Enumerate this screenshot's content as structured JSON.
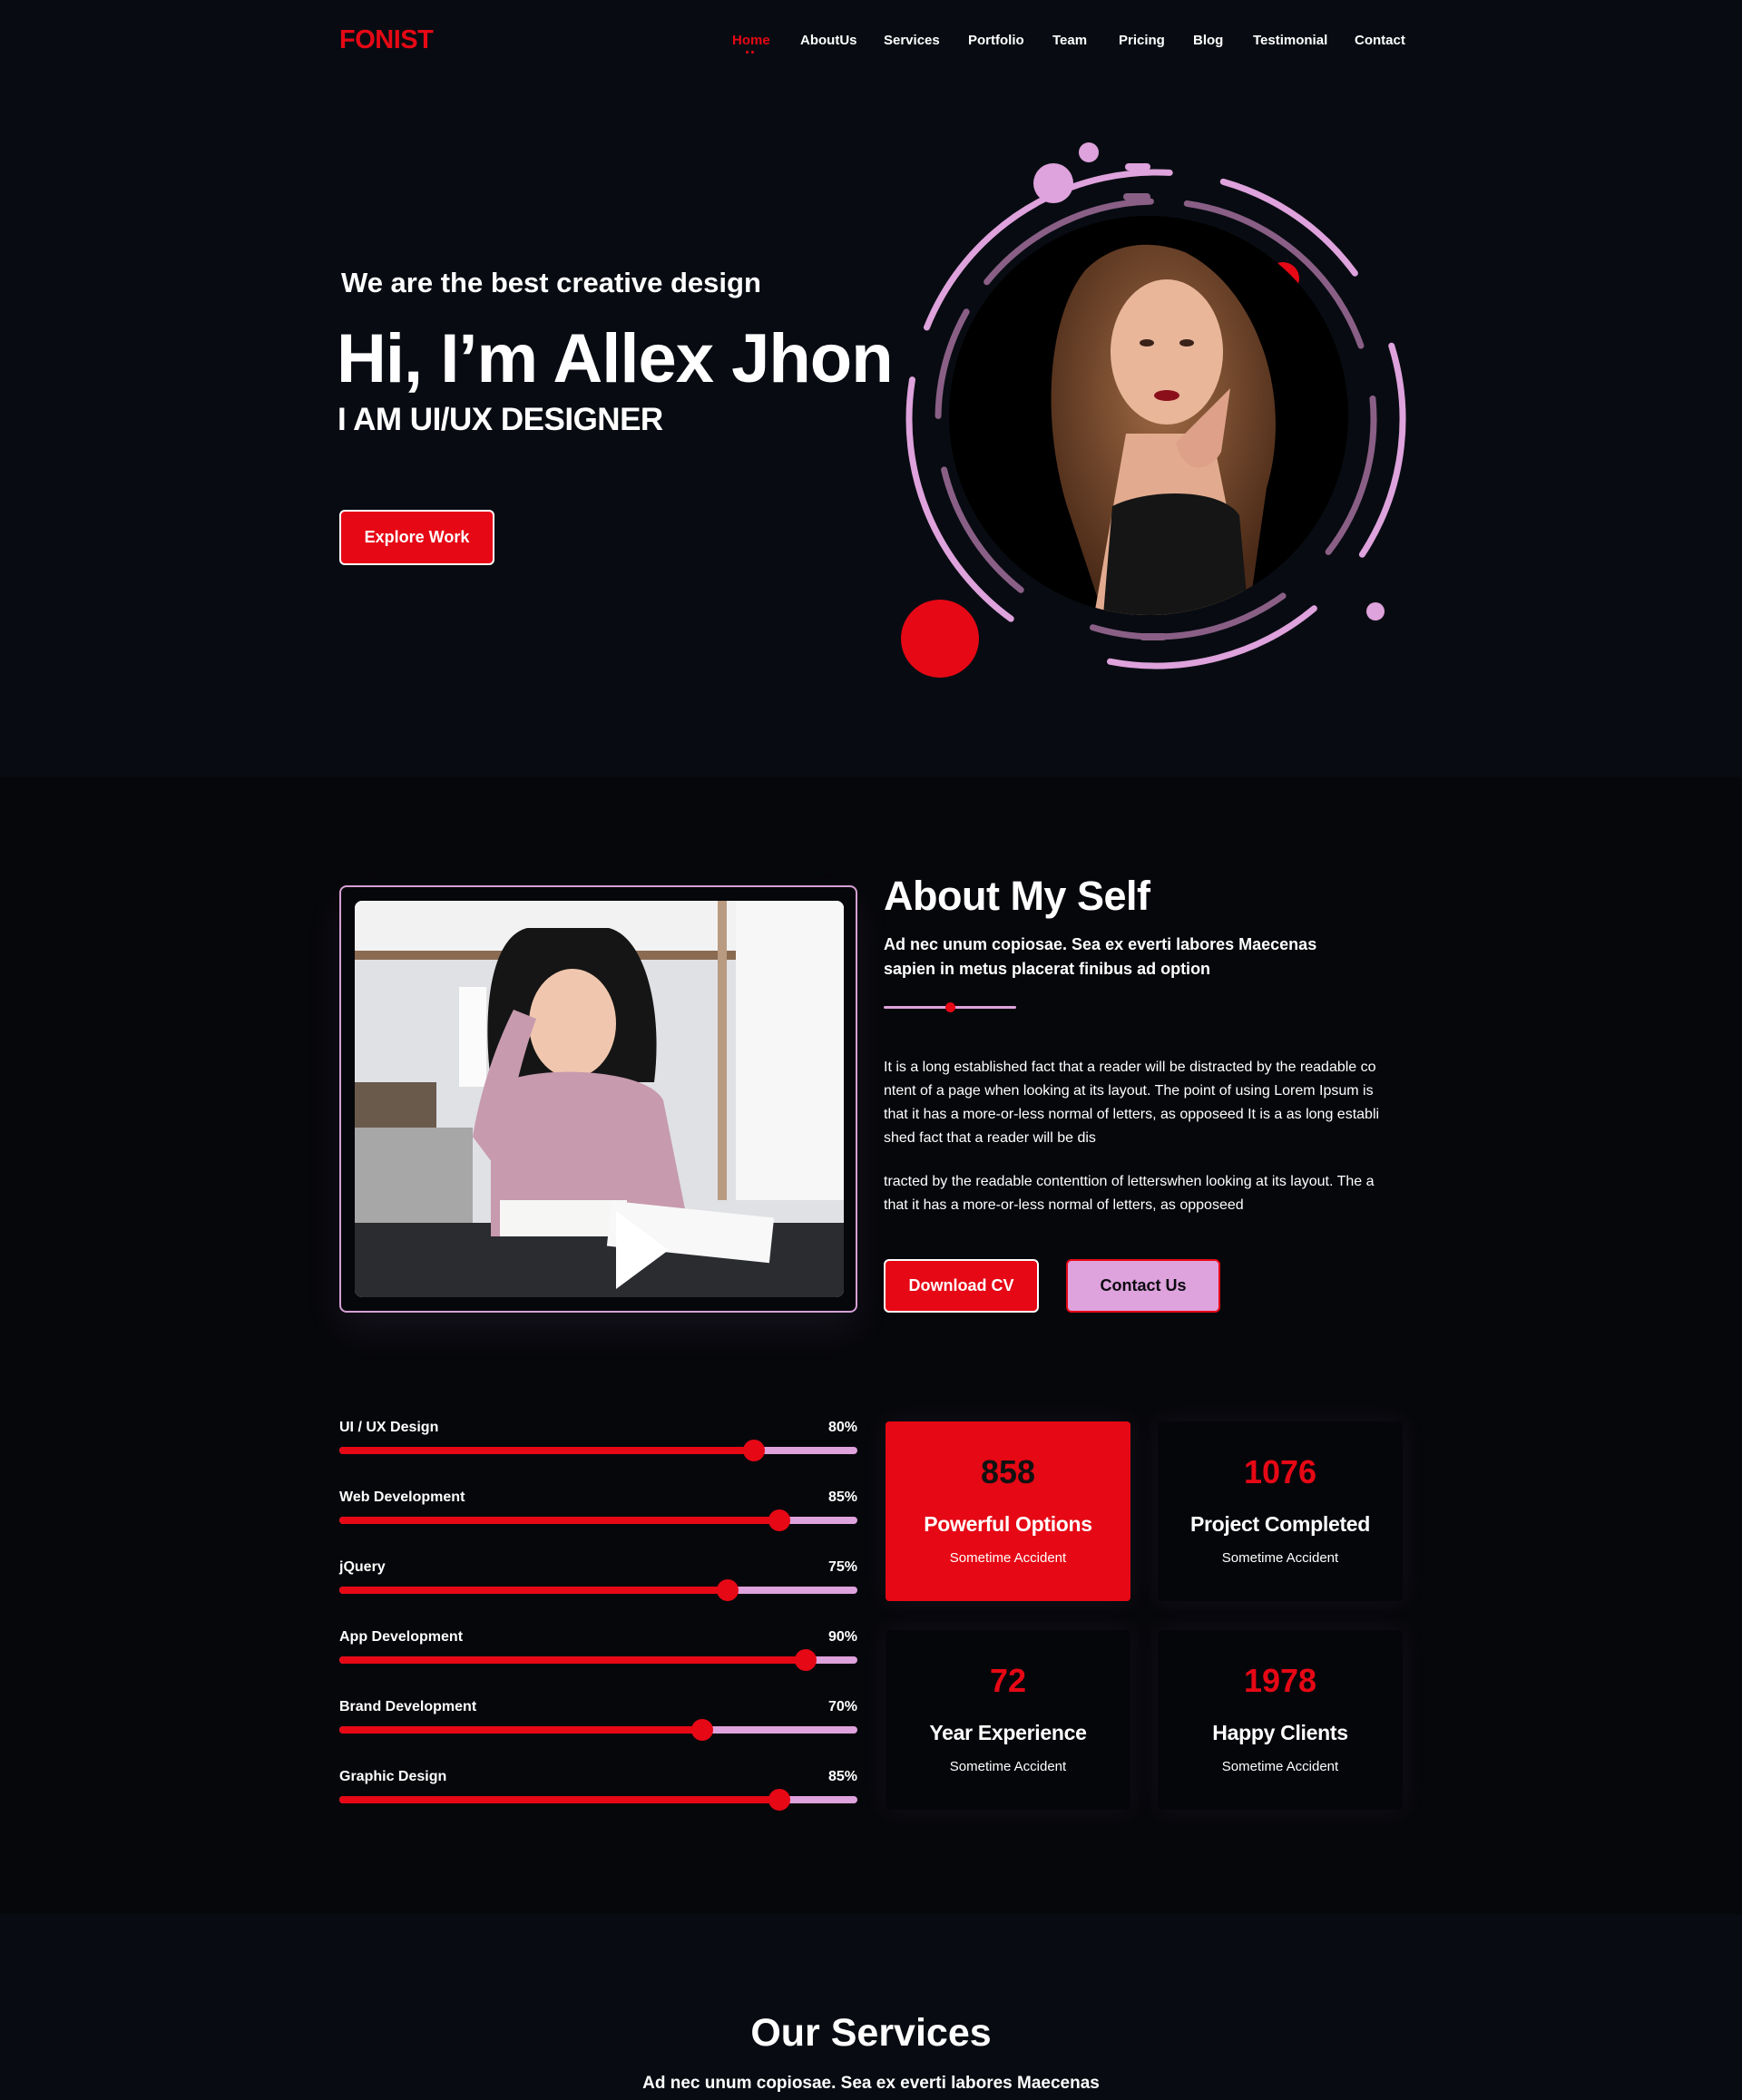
{
  "brand": {
    "logo": "FONIST"
  },
  "nav": {
    "items": [
      {
        "label": "Home",
        "active": true
      },
      {
        "label": "AboutUs",
        "active": false
      },
      {
        "label": "Services",
        "active": false
      },
      {
        "label": "Portfolio",
        "active": false
      },
      {
        "label": "Team",
        "active": false
      },
      {
        "label": "Pricing",
        "active": false
      },
      {
        "label": "Blog",
        "active": false
      },
      {
        "label": "Testimonial",
        "active": false
      },
      {
        "label": "Contact",
        "active": false
      }
    ]
  },
  "hero": {
    "tagline": "We are the best creative design",
    "title": "Hi, I’m Allex Jhon",
    "role": "I AM UI/UX DESIGNER",
    "cta": "Explore Work"
  },
  "about": {
    "title": "About My Self",
    "subtitle": "Ad nec unum copiosae. Sea ex everti labores Maecenas sapien in metus placerat finibus ad option",
    "paragraph1": "It is a long established fact that a reader will be distracted by the readable co ntent of a page when looking at its layout. The point of using Lorem Ipsum is that it has a more-or-less normal of letters, as opposeed It is a as long establi shed fact that a reader will be dis",
    "paragraph2": "tracted by the readable contenttion of letterswhen looking at its layout. The a that it has a more-or-less normal of letters, as opposeed",
    "download_label": "Download CV",
    "contact_label": "Contact Us"
  },
  "skills": [
    {
      "name": "UI / UX Design",
      "value_label": "80%",
      "level": 0.8
    },
    {
      "name": "Web Development",
      "value_label": "85%",
      "level": 0.85
    },
    {
      "name": "jQuery",
      "value_label": "75%",
      "level": 0.75
    },
    {
      "name": "App Development",
      "value_label": "90%",
      "level": 0.9
    },
    {
      "name": "Brand Development",
      "value_label": "70%",
      "level": 0.7
    },
    {
      "name": "Graphic Design",
      "value_label": "85%",
      "level": 0.85
    }
  ],
  "stats": [
    {
      "number": "858",
      "label": "Powerful Options",
      "sub": "Sometime Accident",
      "active": true
    },
    {
      "number": "1076",
      "label": "Project Completed",
      "sub": "Sometime Accident",
      "active": false
    },
    {
      "number": "72",
      "label": "Year Experience",
      "sub": "Sometime Accident",
      "active": false
    },
    {
      "number": "1978",
      "label": "Happy Clients",
      "sub": "Sometime Accident",
      "active": false
    }
  ],
  "services": {
    "title": "Our Services",
    "subtitle": "Ad nec unum copiosae. Sea ex everti labores Maecenas"
  },
  "colors": {
    "accent": "#e60815",
    "pink": "#dea2dc",
    "background": "#06070b"
  }
}
